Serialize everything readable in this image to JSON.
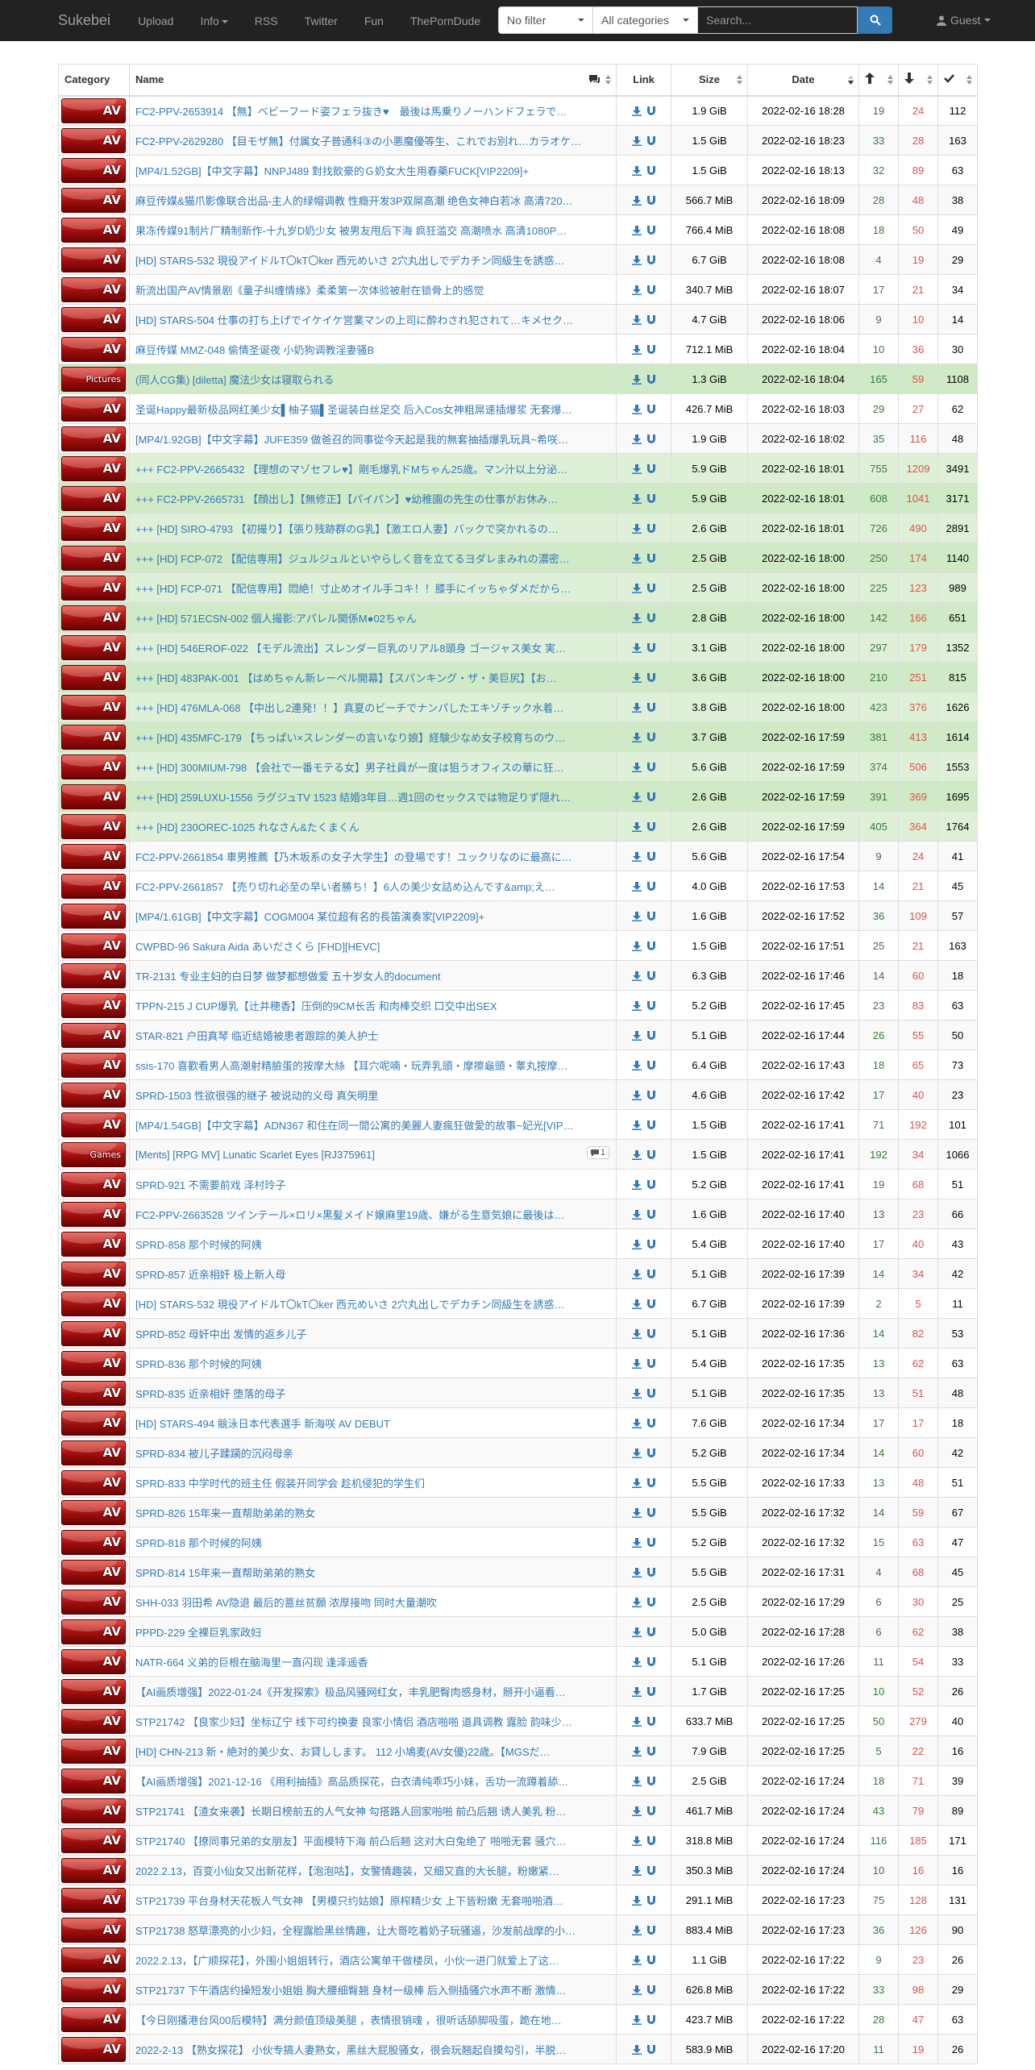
{
  "nav": {
    "brand": "Sukebei",
    "links": [
      "Upload",
      "Info",
      "RSS",
      "Twitter",
      "Fun",
      "ThePornDude"
    ],
    "filter": "No filter",
    "category": "All categories",
    "search_placeholder": "Search...",
    "user": "Guest"
  },
  "table": {
    "headers": [
      "Category",
      "Name",
      "Link",
      "Size",
      "Date"
    ],
    "accent": "#337ab7",
    "trusted_row_color": "#dff0d8",
    "rows": [
      {
        "cat": "AV",
        "name": "FC2-PPV-2653914 【無】ベビーフード姿フェラ抜き♥　最後は馬乗りノーハンドフェラで…",
        "size": "1.9 GiB",
        "date": "2022-02-16 18:28",
        "s": "19",
        "l": "24",
        "c": "112",
        "t": false
      },
      {
        "cat": "AV",
        "name": "FC2-PPV-2629280 【目モザ無】付属女子普通科③の小悪魔優等生、これでお別れ…カラオケ…",
        "size": "1.5 GiB",
        "date": "2022-02-16 18:23",
        "s": "33",
        "l": "28",
        "c": "163",
        "t": false
      },
      {
        "cat": "AV",
        "name": "[MP4/1.52GB]【中文字幕】NNPJ489 對找飲豪的Ｇ奶女大生用春藥FUCK[VIP2209]+",
        "size": "1.5 GiB",
        "date": "2022-02-16 18:13",
        "s": "32",
        "l": "89",
        "c": "63",
        "t": false
      },
      {
        "cat": "AV",
        "name": "麻豆传媒&猫爪影像联合出品-主人的绿帽调教 性瘾开发3P双屌高潮 绝色女神白若冰 高清720…",
        "size": "566.7 MiB",
        "date": "2022-02-16 18:09",
        "s": "28",
        "l": "48",
        "c": "38",
        "t": false
      },
      {
        "cat": "AV",
        "name": "果冻传媒91制片厂精制新作-十九岁D奶少女 被男友甩后下海 疯狂滥交 高潮喷水 高清1080P…",
        "size": "766.4 MiB",
        "date": "2022-02-16 18:08",
        "s": "18",
        "l": "50",
        "c": "49",
        "t": false
      },
      {
        "cat": "AV",
        "name": "[HD] STARS-532 現役アイドルT〇kT〇ker 西元めいさ 2穴丸出しでデカチン同級生を誘惑…",
        "size": "6.7 GiB",
        "date": "2022-02-16 18:08",
        "s": "4",
        "l": "19",
        "c": "29",
        "t": false
      },
      {
        "cat": "AV",
        "name": "新流出国产AV情景剧《量子纠缠情缘》柔柔第一次体验被射在锁骨上的感觉",
        "size": "340.7 MiB",
        "date": "2022-02-16 18:07",
        "s": "17",
        "l": "21",
        "c": "34",
        "t": false
      },
      {
        "cat": "AV",
        "name": "[HD] STARS-504 仕事の打ち上げでイケイケ営業マンの上司に酔わされ犯されて…キメセク…",
        "size": "4.7 GiB",
        "date": "2022-02-16 18:06",
        "s": "9",
        "l": "10",
        "c": "14",
        "t": false
      },
      {
        "cat": "AV",
        "name": "麻豆传媒 MMZ-048 偷情圣诞夜 小奶狗调教淫妻骚B",
        "size": "712.1 MiB",
        "date": "2022-02-16 18:04",
        "s": "10",
        "l": "36",
        "c": "30",
        "t": false
      },
      {
        "cat": "Pictures",
        "name": "(同人CG集) [diletta] 魔法少女は寝取られる",
        "size": "1.3 GiB",
        "date": "2022-02-16 18:04",
        "s": "165",
        "l": "59",
        "c": "1108",
        "t": true
      },
      {
        "cat": "AV",
        "name": "圣诞Happy最新极品网红美少女▌柚子猫▌圣诞装白丝足交 后入Cos女神粗屌速插爆浆 无套爆…",
        "size": "426.7 MiB",
        "date": "2022-02-16 18:03",
        "s": "29",
        "l": "27",
        "c": "62",
        "t": false
      },
      {
        "cat": "AV",
        "name": "[MP4/1.92GB]【中文字幕】JUFE359 做爸召的同事從今天起是我的無套抽插爆乳玩具~希咲…",
        "size": "1.9 GiB",
        "date": "2022-02-16 18:02",
        "s": "35",
        "l": "116",
        "c": "48",
        "t": false
      },
      {
        "cat": "AV",
        "name": "+++ FC2-PPV-2665432 【理想のマゾセフレ♥】剛毛爆乳ドMちゃん25歳。マン汁以上分泌…",
        "size": "5.9 GiB",
        "date": "2022-02-16 18:01",
        "s": "755",
        "l": "1209",
        "c": "3491",
        "t": true
      },
      {
        "cat": "AV",
        "name": "+++ FC2-PPV-2665731 【顔出し】【無修正】【パイパン】♥幼稚園の先生の仕事がお休み…",
        "size": "5.9 GiB",
        "date": "2022-02-16 18:01",
        "s": "608",
        "l": "1041",
        "c": "3171",
        "t": true
      },
      {
        "cat": "AV",
        "name": "+++ [HD] SIRO-4793 【初撮り】【張り残跡群のG乳】【激エロ人妻】バックで突かれるの…",
        "size": "2.6 GiB",
        "date": "2022-02-16 18:01",
        "s": "726",
        "l": "490",
        "c": "2891",
        "t": true
      },
      {
        "cat": "AV",
        "name": "+++ [HD] FCP-072 【配信専用】ジュルジュルといやらしく音を立てるヨダレまみれの濃密…",
        "size": "2.5 GiB",
        "date": "2022-02-16 18:00",
        "s": "250",
        "l": "174",
        "c": "1140",
        "t": true
      },
      {
        "cat": "AV",
        "name": "+++ [HD] FCP-071 【配信専用】悶絶！寸止めオイル手コキ！！膝手にイッちゃダメだから…",
        "size": "2.5 GiB",
        "date": "2022-02-16 18:00",
        "s": "225",
        "l": "123",
        "c": "989",
        "t": true
      },
      {
        "cat": "AV",
        "name": "+++ [HD] 571ECSN-002 個人撮影:アパレル関係M●02ちゃん",
        "size": "2.8 GiB",
        "date": "2022-02-16 18:00",
        "s": "142",
        "l": "166",
        "c": "651",
        "t": true
      },
      {
        "cat": "AV",
        "name": "+++ [HD] 546EROF-022 【モデル流出】スレンダー巨乳のリアル8頭身 ゴージャス美女 実…",
        "size": "3.1 GiB",
        "date": "2022-02-16 18:00",
        "s": "297",
        "l": "179",
        "c": "1352",
        "t": true
      },
      {
        "cat": "AV",
        "name": "+++ [HD] 483PAK-001 【はめちゃん新レーベル開幕】【スパンキング・ザ・美巨尻】【お…",
        "size": "3.6 GiB",
        "date": "2022-02-16 18:00",
        "s": "210",
        "l": "251",
        "c": "815",
        "t": true
      },
      {
        "cat": "AV",
        "name": "+++ [HD] 476MLA-068 【中出し2連発！！】真夏のビーチでナンパしたエキゾチック水着…",
        "size": "3.8 GiB",
        "date": "2022-02-16 18:00",
        "s": "423",
        "l": "376",
        "c": "1626",
        "t": true
      },
      {
        "cat": "AV",
        "name": "+++ [HD] 435MFC-179 【ちっぱい×スレンダーの言いなり娘】経験少なめ女子校育ちのウ…",
        "size": "3.7 GiB",
        "date": "2022-02-16 17:59",
        "s": "381",
        "l": "413",
        "c": "1614",
        "t": true
      },
      {
        "cat": "AV",
        "name": "+++ [HD] 300MIUM-798 【会社で一番モテる女】男子社員が一度は狙うオフィスの華に狂…",
        "size": "5.6 GiB",
        "date": "2022-02-16 17:59",
        "s": "374",
        "l": "506",
        "c": "1553",
        "t": true
      },
      {
        "cat": "AV",
        "name": "+++ [HD] 259LUXU-1556 ラグジュTV 1523 結婚3年目…週1回のセックスでは物足りず隠れ…",
        "size": "2.6 GiB",
        "date": "2022-02-16 17:59",
        "s": "391",
        "l": "369",
        "c": "1695",
        "t": true
      },
      {
        "cat": "AV",
        "name": "+++ [HD] 230OREC-1025 れなさん&たくまくん",
        "size": "2.6 GiB",
        "date": "2022-02-16 17:59",
        "s": "405",
        "l": "364",
        "c": "1764",
        "t": true
      },
      {
        "cat": "AV",
        "name": "FC2-PPV-2661854 車男推薦【乃木坂系の女子大学生】の登場です！ユックリなのに最高に…",
        "size": "5.6 GiB",
        "date": "2022-02-16 17:54",
        "s": "9",
        "l": "24",
        "c": "41",
        "t": false
      },
      {
        "cat": "AV",
        "name": "FC2-PPV-2661857 【売り切れ必至の早い者勝ち！】6人の美少女詰め込んです&amp;え…",
        "size": "4.0 GiB",
        "date": "2022-02-16 17:53",
        "s": "14",
        "l": "21",
        "c": "45",
        "t": false
      },
      {
        "cat": "AV",
        "name": "[MP4/1.61GB]【中文字幕】COGM004 某位超有名的長笛演奏家[VIP2209]+",
        "size": "1.6 GiB",
        "date": "2022-02-16 17:52",
        "s": "36",
        "l": "109",
        "c": "57",
        "t": false
      },
      {
        "cat": "AV",
        "name": "CWPBD-96 Sakura Aida あいださくら [FHD][HEVC]",
        "size": "1.5 GiB",
        "date": "2022-02-16 17:51",
        "s": "25",
        "l": "21",
        "c": "163",
        "t": false
      },
      {
        "cat": "AV",
        "name": "TR-2131 专业主妇的白日梦 做梦都想做爱 五十岁女人的document",
        "size": "6.3 GiB",
        "date": "2022-02-16 17:46",
        "s": "14",
        "l": "60",
        "c": "18",
        "t": false
      },
      {
        "cat": "AV",
        "name": "TPPN-215 J CUP爆乳【辻井穂香】压倒的9CM长舌 和肉棒交织 口交中出SEX",
        "size": "5.2 GiB",
        "date": "2022-02-16 17:45",
        "s": "23",
        "l": "83",
        "c": "63",
        "t": false
      },
      {
        "cat": "AV",
        "name": "STAR-821 户田真琴 临近结婚被患者跟踪的美人护士",
        "size": "5.1 GiB",
        "date": "2022-02-16 17:44",
        "s": "26",
        "l": "55",
        "c": "50",
        "t": false
      },
      {
        "cat": "AV",
        "name": "ssis-170 喜歡看男人高潮射精臉蛋的按摩大絲 【耳穴呢喃・玩弄乳頭・摩擦龜頭・睾丸按摩…",
        "size": "6.4 GiB",
        "date": "2022-02-16 17:43",
        "s": "18",
        "l": "65",
        "c": "73",
        "t": false
      },
      {
        "cat": "AV",
        "name": "SPRD-1503 性欲很强的继子 被说动的义母 真矢明里",
        "size": "4.6 GiB",
        "date": "2022-02-16 17:42",
        "s": "17",
        "l": "40",
        "c": "23",
        "t": false
      },
      {
        "cat": "AV",
        "name": "[MP4/1.54GB]【中文字幕】ADN367 和住在同一間公寓的美麗人妻瘋狂做愛的故事~妃光[VIP…",
        "size": "1.5 GiB",
        "date": "2022-02-16 17:41",
        "s": "71",
        "l": "192",
        "c": "101",
        "t": false
      },
      {
        "cat": "Games",
        "name": "[Ments] [RPG MV] Lunatic Scarlet Eyes [RJ375961]",
        "size": "1.5 GiB",
        "date": "2022-02-16 17:41",
        "s": "192",
        "l": "34",
        "c": "1066",
        "t": false,
        "comments": "1"
      },
      {
        "cat": "AV",
        "name": "SPRD-921 不需要前戏 泽村玲子",
        "size": "5.2 GiB",
        "date": "2022-02-16 17:41",
        "s": "19",
        "l": "68",
        "c": "51",
        "t": false
      },
      {
        "cat": "AV",
        "name": "FC2-PPV-2663528 ツインテール×ロリ×黒髪メイド嬢麻里19歳、嫌がる生意気娘に最後は…",
        "size": "1.6 GiB",
        "date": "2022-02-16 17:40",
        "s": "13",
        "l": "23",
        "c": "66",
        "t": false
      },
      {
        "cat": "AV",
        "name": "SPRD-858 那个时候的阿姨",
        "size": "5.4 GiB",
        "date": "2022-02-16 17:40",
        "s": "17",
        "l": "40",
        "c": "43",
        "t": false
      },
      {
        "cat": "AV",
        "name": "SPRD-857 近亲相奸 极上新人母",
        "size": "5.1 GiB",
        "date": "2022-02-16 17:39",
        "s": "14",
        "l": "34",
        "c": "42",
        "t": false
      },
      {
        "cat": "AV",
        "name": " [HD] STARS-532 現役アイドルT〇kT〇ker 西元めいさ 2穴丸出しでデカチン同級生を誘惑…",
        "size": "6.7 GiB",
        "date": "2022-02-16 17:39",
        "s": "2",
        "l": "5",
        "c": "11",
        "t": false
      },
      {
        "cat": "AV",
        "name": "SPRD-852 母奸中出 发情的返乡儿子",
        "size": "5.1 GiB",
        "date": "2022-02-16 17:36",
        "s": "14",
        "l": "82",
        "c": "53",
        "t": false
      },
      {
        "cat": "AV",
        "name": "SPRD-836 那个时候的阿姨",
        "size": "5.4 GiB",
        "date": "2022-02-16 17:35",
        "s": "13",
        "l": "62",
        "c": "63",
        "t": false
      },
      {
        "cat": "AV",
        "name": "SPRD-835 近亲相奸 堕落的母子",
        "size": "5.1 GiB",
        "date": "2022-02-16 17:35",
        "s": "13",
        "l": "51",
        "c": "48",
        "t": false
      },
      {
        "cat": "AV",
        "name": " [HD] STARS-494 競泳日本代表選手 新海咲 AV DEBUT",
        "size": "7.6 GiB",
        "date": "2022-02-16 17:34",
        "s": "17",
        "l": "17",
        "c": "18",
        "t": false
      },
      {
        "cat": "AV",
        "name": "SPRD-834 被儿子蹂躏的沉闷母亲",
        "size": "5.2 GiB",
        "date": "2022-02-16 17:34",
        "s": "14",
        "l": "60",
        "c": "42",
        "t": false
      },
      {
        "cat": "AV",
        "name": "SPRD-833 中学时代的班主任 假装开同学会 趁机侵犯的学生们",
        "size": "5.5 GiB",
        "date": "2022-02-16 17:33",
        "s": "13",
        "l": "48",
        "c": "51",
        "t": false
      },
      {
        "cat": "AV",
        "name": "SPRD-826 15年来一直帮助弟弟的熟女",
        "size": "5.5 GiB",
        "date": "2022-02-16 17:32",
        "s": "14",
        "l": "59",
        "c": "67",
        "t": false
      },
      {
        "cat": "AV",
        "name": "SPRD-818 那个时候的阿姨",
        "size": "5.2 GiB",
        "date": "2022-02-16 17:32",
        "s": "15",
        "l": "63",
        "c": "47",
        "t": false
      },
      {
        "cat": "AV",
        "name": "SPRD-814 15年来一直帮助弟弟的熟女",
        "size": "5.5 GiB",
        "date": "2022-02-16 17:31",
        "s": "4",
        "l": "68",
        "c": "45",
        "t": false
      },
      {
        "cat": "AV",
        "name": "SHH-033 羽田希 AV隐退 最后的蔷丝贫願 浓厚接吻 同时大量潮吹",
        "size": "2.5 GiB",
        "date": "2022-02-16 17:29",
        "s": "6",
        "l": "30",
        "c": "25",
        "t": false
      },
      {
        "cat": "AV",
        "name": "PPPD-229 全裸巨乳家政妇",
        "size": "5.0 GiB",
        "date": "2022-02-16 17:28",
        "s": "6",
        "l": "62",
        "c": "38",
        "t": false
      },
      {
        "cat": "AV",
        "name": "NATR-664 义弟的巨根在脑海里一直闪现 逢泽遥香",
        "size": "5.1 GiB",
        "date": "2022-02-16 17:26",
        "s": "11",
        "l": "54",
        "c": "33",
        "t": false
      },
      {
        "cat": "AV",
        "name": "【AI画质增强】2022-01-24《开发探索》极品风骚网红女，丰乳肥臀肉感身材，掰开小逼看…",
        "size": "1.7 GiB",
        "date": "2022-02-16 17:25",
        "s": "10",
        "l": "52",
        "c": "26",
        "t": false
      },
      {
        "cat": "AV",
        "name": "STP21742 【良家少妇】坐标辽宁 线下可约换妻 良家小情侣 酒店啪啪 道具调教 露脸 韵味少…",
        "size": "633.7 MiB",
        "date": "2022-02-16 17:25",
        "s": "50",
        "l": "279",
        "c": "40",
        "t": false
      },
      {
        "cat": "AV",
        "name": " [HD] CHN-213 新・絶対的美少女、お貸しします。 112 小鳩麦(AV女優)22歳。【MGSだ…",
        "size": "7.9 GiB",
        "date": "2022-02-16 17:25",
        "s": "5",
        "l": "22",
        "c": "16",
        "t": false
      },
      {
        "cat": "AV",
        "name": "【AI画质增强】2021-12-16 《用利抽插》高品质探花，白衣清纯乖巧小妹，舌功一流蹲着舔…",
        "size": "2.5 GiB",
        "date": "2022-02-16 17:24",
        "s": "18",
        "l": "71",
        "c": "39",
        "t": false
      },
      {
        "cat": "AV",
        "name": "STP21741 【渣女来袭】长期日榜前五的人气女神 勾搭路人回家啪啪 前凸后翘 诱人美乳 粉…",
        "size": "461.7 MiB",
        "date": "2022-02-16 17:24",
        "s": "43",
        "l": "79",
        "c": "89",
        "t": false
      },
      {
        "cat": "AV",
        "name": "STP21740 【撩同事兄弟的女朋友】平面模特下海 前凸后翘 这对大白兔绝了 啪啪无套 骚穴…",
        "size": "318.8 MiB",
        "date": "2022-02-16 17:24",
        "s": "116",
        "l": "185",
        "c": "171",
        "t": false
      },
      {
        "cat": "AV",
        "name": "2022.2.13，百变小仙女又出新花样，【泡泡咕】，女警情趣装，又细又直的大长腿，粉嫩紧…",
        "size": "350.3 MiB",
        "date": "2022-02-16 17:24",
        "s": "10",
        "l": "16",
        "c": "16",
        "t": false
      },
      {
        "cat": "AV",
        "name": "STP21739 平台身材天花板人气女神 【男模只约姑娘】原榨精少女 上下皆粉嫩 无套啪啪酒…",
        "size": "291.1 MiB",
        "date": "2022-02-16 17:23",
        "s": "75",
        "l": "128",
        "c": "131",
        "t": false
      },
      {
        "cat": "AV",
        "name": "STP21738 怒草漂亮的小少妇，全程露脸黑丝情趣，让大哥吃着奶子玩骚逼，沙发前战摩的小…",
        "size": "883.4 MiB",
        "date": "2022-02-16 17:23",
        "s": "36",
        "l": "126",
        "c": "90",
        "t": false
      },
      {
        "cat": "AV",
        "name": "2022.2.13，【广顺探花】，外围小姐姐转行，酒店公寓单干做楼凤，小伙一进门就爱上了这…",
        "size": "1.1 GiB",
        "date": "2022-02-16 17:22",
        "s": "9",
        "l": "23",
        "c": "26",
        "t": false
      },
      {
        "cat": "AV",
        "name": "STP21737 下午酒店约操短发小姐姐 胸大腰细臀翘 身材一级棒 后入侧插骚穴水声不断 激情…",
        "size": "626.8 MiB",
        "date": "2022-02-16 17:22",
        "s": "33",
        "l": "98",
        "c": "29",
        "t": false
      },
      {
        "cat": "AV",
        "name": "【今日刚播港台风00后模特】满分颜值顶级美腿 ，表情很销魂 ，很听话舔脚吸蛋，跪在地…",
        "size": "423.7 MiB",
        "date": "2022-02-16 17:22",
        "s": "28",
        "l": "47",
        "c": "63",
        "t": false
      },
      {
        "cat": "AV",
        "name": "2022-2-13 【熟女探花】 小伙专搞人妻熟女，黑丝大屁股骚女，很会玩翘起自摸勾引，半脱…",
        "size": "583.9 MiB",
        "date": "2022-02-16 17:20",
        "s": "11",
        "l": "19",
        "c": "26",
        "t": false
      }
    ]
  }
}
